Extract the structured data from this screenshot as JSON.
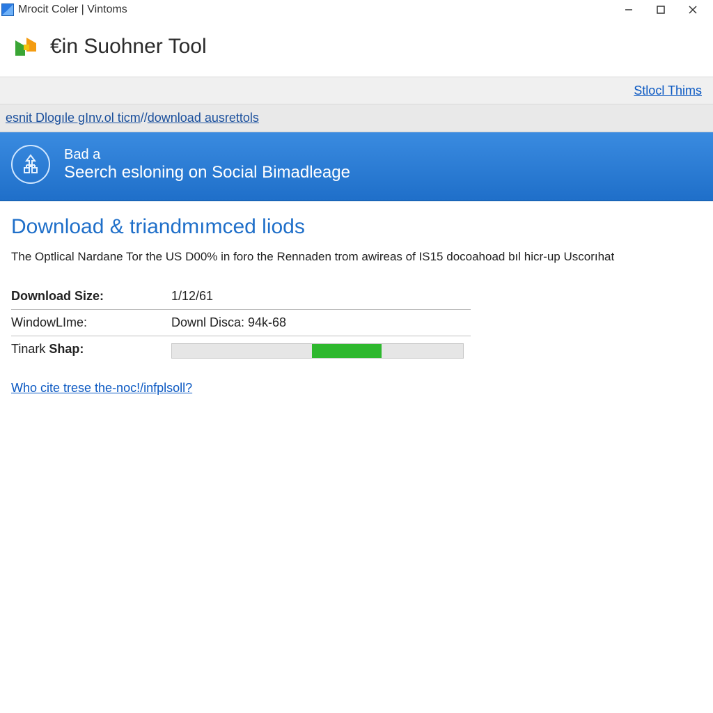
{
  "window": {
    "title": "Mrocit Coler | Vintoms"
  },
  "app": {
    "title": "€in Suohner Tool"
  },
  "info_band": {
    "right_link": "Stlocl Thims"
  },
  "crumb": {
    "link1": "esnit Dlogıle gInv.ol ticm",
    "sep": " //",
    "link2": "download ausrettols"
  },
  "banner": {
    "line1": "Bad a",
    "line2": "Seerch esloning on Social Bimadleage"
  },
  "section": {
    "title": "Download & triandmımced liods",
    "desc": "The Optlical Nardane Tor the US D00% in foro the Rennaden trom awireas of IS15 docoahoad bıl hicr-up Uscorıhat"
  },
  "details": {
    "row1": {
      "label": "Download Size:",
      "value": "1/12/61"
    },
    "row2": {
      "label": "WindowLIme:",
      "value": "Downl Disca: 94k-68"
    },
    "row3": {
      "label_prefix": "Tinark ",
      "label_bold": "Shap:"
    }
  },
  "help_link": "Who cite trese the-noc!/infplsoll?"
}
